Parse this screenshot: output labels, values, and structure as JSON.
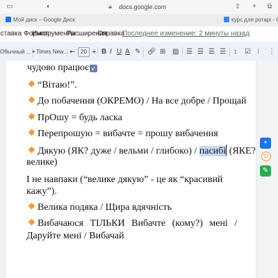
{
  "browser": {
    "url": "docs.google.com",
    "tabs": [
      {
        "label": "Мой диск – Google Диск",
        "favicon_color": "#1a73e8"
      },
      {
        "label": "курс для ротарі - Google Docs",
        "favicon_color": "#4285f4"
      }
    ]
  },
  "menu": {
    "items": [
      "Вставка",
      "Формат",
      "Инструменты",
      "Расширения",
      "Справка"
    ],
    "last_edit": "Последнее изменение: 2 минуты назад"
  },
  "toolbar": {
    "style": "Обычный ...",
    "font": "Times New...",
    "minus": "−",
    "font_size": "20",
    "plus": "+",
    "bold": "B",
    "italic": "I",
    "underline": "U",
    "text_color": "A"
  },
  "document": {
    "lines": [
      "чудово працює",
      "“Вітаю!”.",
      "До побачення (ОКРЕМО) / На все добре / Прощай",
      "ПрОшу = будь ласка",
      "Перепрошую = вибачте = прошу вибачення",
      "Дякую (ЯК? дуже / вельми / глибоко) / ",
      "пасибі",
      " (ЯКЕ?",
      "велике)",
      "І не навпаки (“велике дякую” - це як “красивий",
      "кажу”).",
      "Велика подяка / Щира вдячність",
      "Вибачаюся ТІЛЬКИ Вибачте (кому?) мені /",
      "Даруйте мені / Вибачай"
    ],
    "accent_color": "#f29c38",
    "highlight_color": "#c7daf6"
  }
}
